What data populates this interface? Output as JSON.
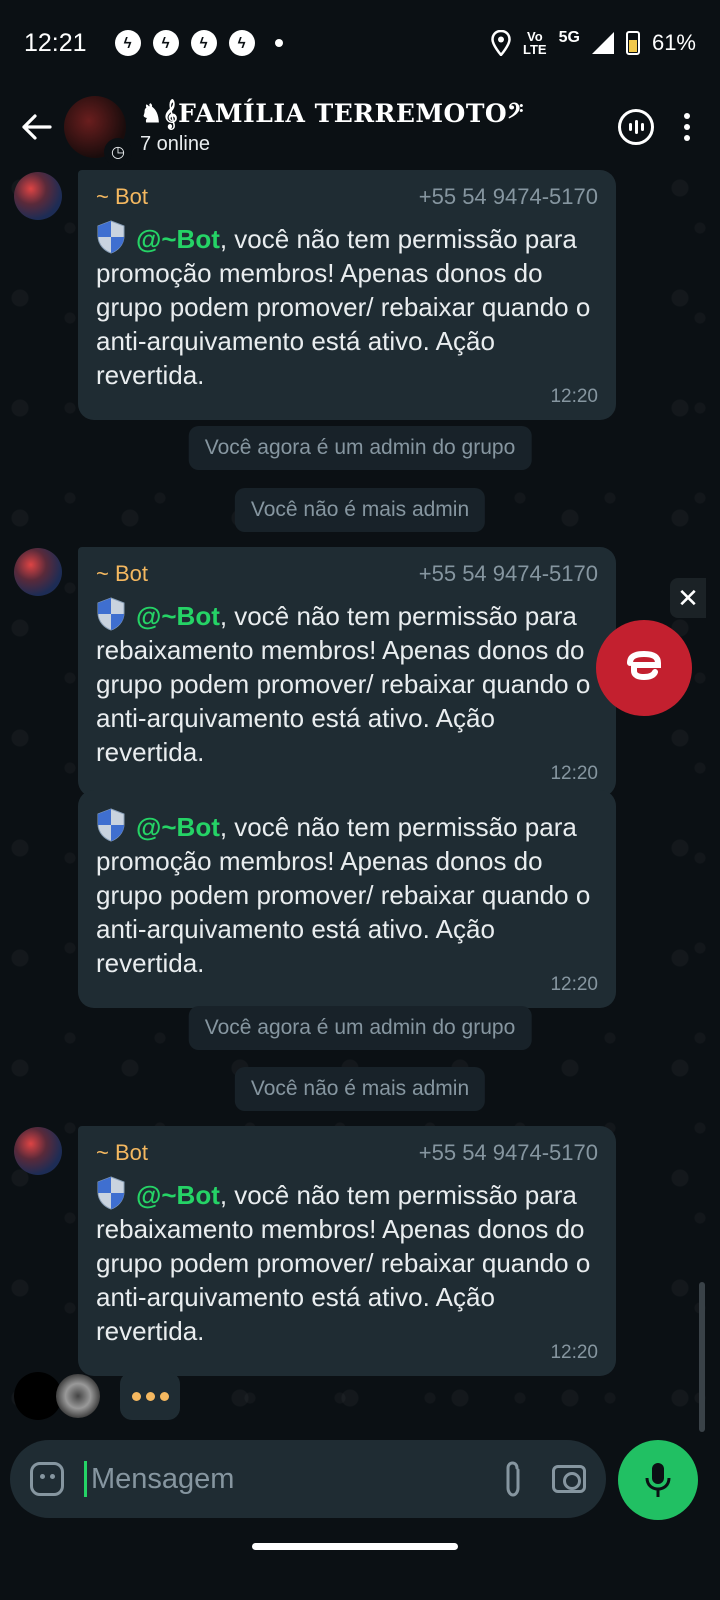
{
  "status_bar": {
    "time": "12:21",
    "network_top": "Vo",
    "network_bottom": "LTE",
    "network_type": "5G",
    "battery": "61%"
  },
  "header": {
    "back_icon": "arrow-back-icon",
    "title": "♞𝄞FAMÍLIA TERREMOTO𝄢",
    "subtitle": "7 online",
    "voice_icon": "voice-chat-icon",
    "menu_icon": "more-vert-icon"
  },
  "messages": [
    {
      "sender": "~ Bot",
      "phone": "+55 54 9474-5170",
      "mention": "@~Bot",
      "text": ", você não tem permissão para promoção membros! Apenas donos do grupo podem promover/ rebaixar quando o anti-arquivamento está ativo. Ação revertida.",
      "time": "12:20"
    },
    {
      "system": "Você agora é um admin do grupo"
    },
    {
      "system": "Você não é mais admin"
    },
    {
      "sender": "~ Bot",
      "phone": "+55 54 9474-5170",
      "mention": "@~Bot",
      "text": ", você não tem permissão para rebaixamento membros! Apenas donos do grupo podem promover/ rebaixar quando o anti-arquivamento está ativo. Ação revertida.",
      "time": "12:20"
    },
    {
      "mention": "@~Bot",
      "text": ", você não tem permissão para promoção membros! Apenas donos do grupo podem promover/ rebaixar quando o anti-arquivamento está ativo. Ação revertida.",
      "time": "12:20"
    },
    {
      "system": "Você agora é um admin do grupo"
    },
    {
      "system": "Você não é mais admin"
    },
    {
      "sender": "~ Bot",
      "phone": "+55 54 9474-5170",
      "mention": "@~Bot",
      "text": ", você não tem permissão para rebaixamento membros! Apenas donos do grupo podem promover/ rebaixar quando o anti-arquivamento está ativo. Ação revertida.",
      "time": "12:20"
    }
  ],
  "composer": {
    "placeholder": "Mensagem",
    "emoji_icon": "sticker-icon",
    "attach_icon": "paperclip-icon",
    "camera_icon": "camera-icon",
    "mic_icon": "mic-icon"
  },
  "colors": {
    "background": "#0b1014",
    "bubble": "#1f2c33",
    "sender": "#f4b860",
    "mention": "#25d366",
    "mic_button": "#21c063"
  }
}
